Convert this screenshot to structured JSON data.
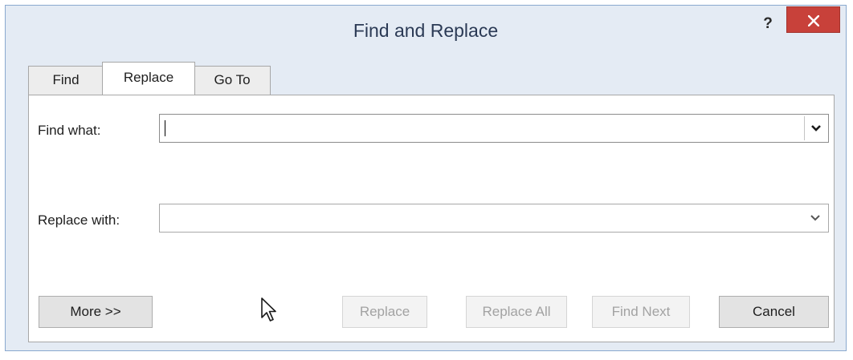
{
  "window": {
    "title": "Find and Replace",
    "help_label": "?"
  },
  "tabs": [
    {
      "label": "Find",
      "selected": false
    },
    {
      "label": "Replace",
      "selected": true
    },
    {
      "label": "Go To",
      "selected": false
    }
  ],
  "fields": {
    "find_what": {
      "label": "Find what:",
      "value": ""
    },
    "replace_with": {
      "label": "Replace with:",
      "value": ""
    }
  },
  "buttons": {
    "more": "More >>",
    "replace": "Replace",
    "replace_all": "Replace All",
    "find_next": "Find Next",
    "cancel": "Cancel"
  },
  "icons": {
    "close": "close-icon",
    "dropdown": "chevron-down-icon",
    "pointer": "mouse-pointer-icon"
  },
  "colors": {
    "close_button": "#c8413a",
    "window_frame": "#e4ebf4",
    "disabled_text": "#a2a2a2"
  }
}
